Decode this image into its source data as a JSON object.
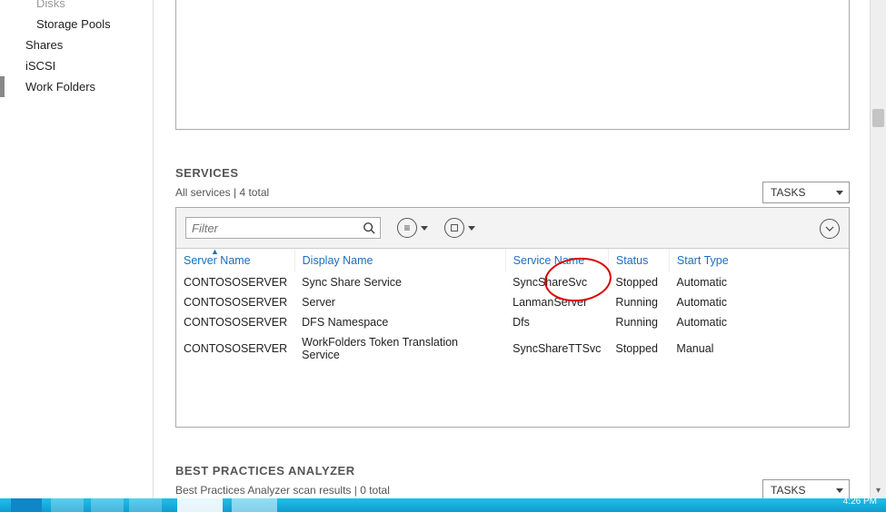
{
  "sidebar": {
    "items": [
      {
        "label": "Disks",
        "indent": 2,
        "cut": true
      },
      {
        "label": "Storage Pools",
        "indent": 2
      },
      {
        "label": "Shares",
        "indent": 1
      },
      {
        "label": "iSCSI",
        "indent": 1
      },
      {
        "label": "Work Folders",
        "indent": 1,
        "active": true
      }
    ]
  },
  "services": {
    "title": "SERVICES",
    "subtitle": "All services | 4 total",
    "tasks_label": "TASKS",
    "filter_placeholder": "Filter",
    "columns": [
      "Server Name",
      "Display Name",
      "Service Name",
      "Status",
      "Start Type"
    ],
    "sort_column_index": 0,
    "rows": [
      {
        "server": "CONTOSOSERVER",
        "display": "Sync Share Service",
        "service": "SyncShareSvc",
        "status": "Stopped",
        "start": "Automatic"
      },
      {
        "server": "CONTOSOSERVER",
        "display": "Server",
        "service": "LanmanServer",
        "status": "Running",
        "start": "Automatic"
      },
      {
        "server": "CONTOSOSERVER",
        "display": "DFS Namespace",
        "service": "Dfs",
        "status": "Running",
        "start": "Automatic"
      },
      {
        "server": "CONTOSOSERVER",
        "display": "WorkFolders Token Translation Service",
        "service": "SyncShareTTSvc",
        "status": "Stopped",
        "start": "Manual"
      }
    ]
  },
  "bpa": {
    "title": "BEST PRACTICES ANALYZER",
    "subtitle": "Best Practices Analyzer scan results | 0 total",
    "tasks_label": "TASKS"
  },
  "taskbar": {
    "clock": "4:26 PM"
  },
  "annotation": {
    "target": "Status column header / first row Stopped value"
  }
}
